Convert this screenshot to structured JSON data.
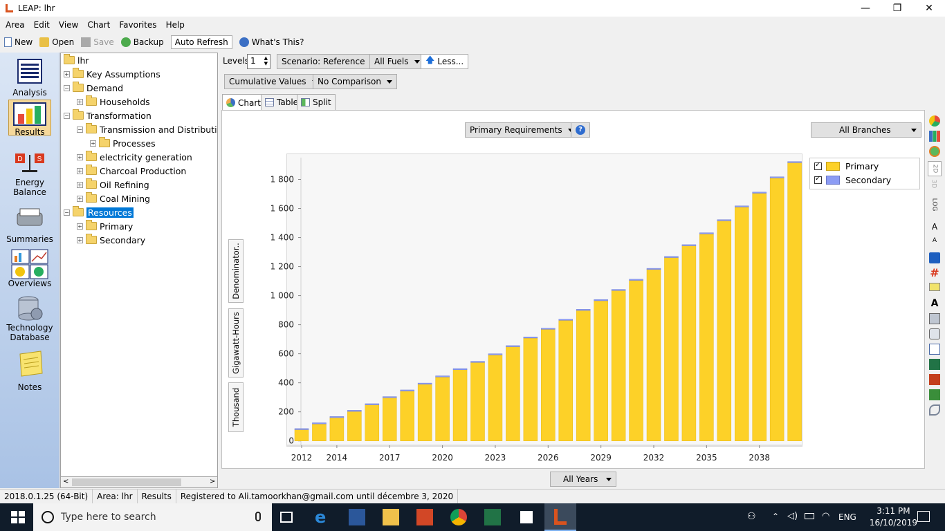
{
  "window": {
    "title": "LEAP: lhr"
  },
  "menu": [
    "Area",
    "Edit",
    "View",
    "Chart",
    "Favorites",
    "Help"
  ],
  "toolbar": {
    "new": "New",
    "open": "Open",
    "save": "Save",
    "backup": "Backup",
    "auto_refresh": "Auto Refresh",
    "whats_this": "What's This?"
  },
  "left_panel": {
    "analysis": "Analysis",
    "results": "Results",
    "energy_balance_1": "Energy",
    "energy_balance_2": "Balance",
    "summaries": "Summaries",
    "overviews": "Overviews",
    "technology_1": "Technology",
    "technology_2": "Database",
    "notes": "Notes"
  },
  "tree": [
    {
      "label": "lhr",
      "level": 0,
      "pm": ""
    },
    {
      "label": "Key Assumptions",
      "level": 1,
      "pm": "+"
    },
    {
      "label": "Demand",
      "level": 1,
      "pm": "-"
    },
    {
      "label": "Households",
      "level": 2,
      "pm": "+"
    },
    {
      "label": "Transformation",
      "level": 1,
      "pm": "-"
    },
    {
      "label": "Transmission and Distributio",
      "level": 2,
      "pm": "-"
    },
    {
      "label": "Processes",
      "level": 3,
      "pm": "+"
    },
    {
      "label": "electricity generation",
      "level": 2,
      "pm": "+"
    },
    {
      "label": "Charcoal Production",
      "level": 2,
      "pm": "+"
    },
    {
      "label": "Oil Refining",
      "level": 2,
      "pm": "+"
    },
    {
      "label": "Coal Mining",
      "level": 2,
      "pm": "+"
    },
    {
      "label": "Resources",
      "level": 1,
      "pm": "-",
      "selected": true
    },
    {
      "label": "Primary",
      "level": 2,
      "pm": "+"
    },
    {
      "label": "Secondary",
      "level": 2,
      "pm": "+"
    }
  ],
  "controls": {
    "levels_label": "Levels:",
    "levels_value": "1",
    "scenario": "Scenario: Reference",
    "fuels": "All Fuels",
    "less": "Less...",
    "cumulative": "Cumulative Values",
    "comparison": "No Comparison",
    "tab_chart": "Chart",
    "tab_table": "Table",
    "tab_split": "Split",
    "variable": "Primary Requirements",
    "help": "?",
    "branches": "All Branches",
    "years": "All Years"
  },
  "axis_labels": {
    "denominator": "Denominator..",
    "unit": "Gigawatt-Hours",
    "scale": "Thousand"
  },
  "chart_data": {
    "type": "bar",
    "stacked": true,
    "x": [
      2012,
      2013,
      2014,
      2015,
      2016,
      2017,
      2018,
      2019,
      2020,
      2021,
      2022,
      2023,
      2024,
      2025,
      2026,
      2027,
      2028,
      2029,
      2030,
      2031,
      2032,
      2033,
      2034,
      2035,
      2036,
      2037,
      2038,
      2039,
      2040
    ],
    "x_tick_labels": [
      "2012",
      "2014",
      "2017",
      "2020",
      "2023",
      "2026",
      "2029",
      "2032",
      "2035",
      "2038"
    ],
    "x_tick_values": [
      2012,
      2014,
      2017,
      2020,
      2023,
      2026,
      2029,
      2032,
      2035,
      2038
    ],
    "series": [
      {
        "name": "Primary",
        "color": "#fdd128",
        "values": [
          77,
          117,
          160,
          203,
          248,
          297,
          343,
          390,
          440,
          490,
          540,
          592,
          648,
          708,
          768,
          830,
          898,
          965,
          1035,
          1105,
          1180,
          1262,
          1343,
          1425,
          1515,
          1610,
          1705,
          1810,
          1915
        ]
      },
      {
        "name": "Secondary",
        "color": "#8c9cf4",
        "values": [
          8,
          8,
          8,
          8,
          8,
          8,
          8,
          8,
          8,
          8,
          8,
          8,
          8,
          8,
          8,
          8,
          8,
          8,
          8,
          8,
          8,
          8,
          8,
          8,
          8,
          8,
          8,
          8,
          8
        ]
      }
    ],
    "y_ticks": [
      "0",
      "200",
      "400",
      "600",
      "800",
      "1 000",
      "1 200",
      "1 400",
      "1 600",
      "1 800"
    ],
    "y_tick_values": [
      0,
      200,
      400,
      600,
      800,
      1000,
      1200,
      1400,
      1600,
      1800
    ],
    "ylim": [
      -30,
      1950
    ],
    "legend_position": "right",
    "grid": false
  },
  "status": {
    "version": "2018.0.1.25 (64-Bit)",
    "area": "Area: lhr",
    "view": "Results",
    "registered": "Registered to Ali.tamoorkhan@gmail.com until décembre 3, 2020"
  },
  "taskbar": {
    "search_placeholder": "Type here to search",
    "lang": "ENG",
    "time": "3:11 PM",
    "date": "16/10/2019"
  },
  "right_toolbar_labels": {
    "d": "2D",
    "three": "3D",
    "log": "LOG"
  }
}
